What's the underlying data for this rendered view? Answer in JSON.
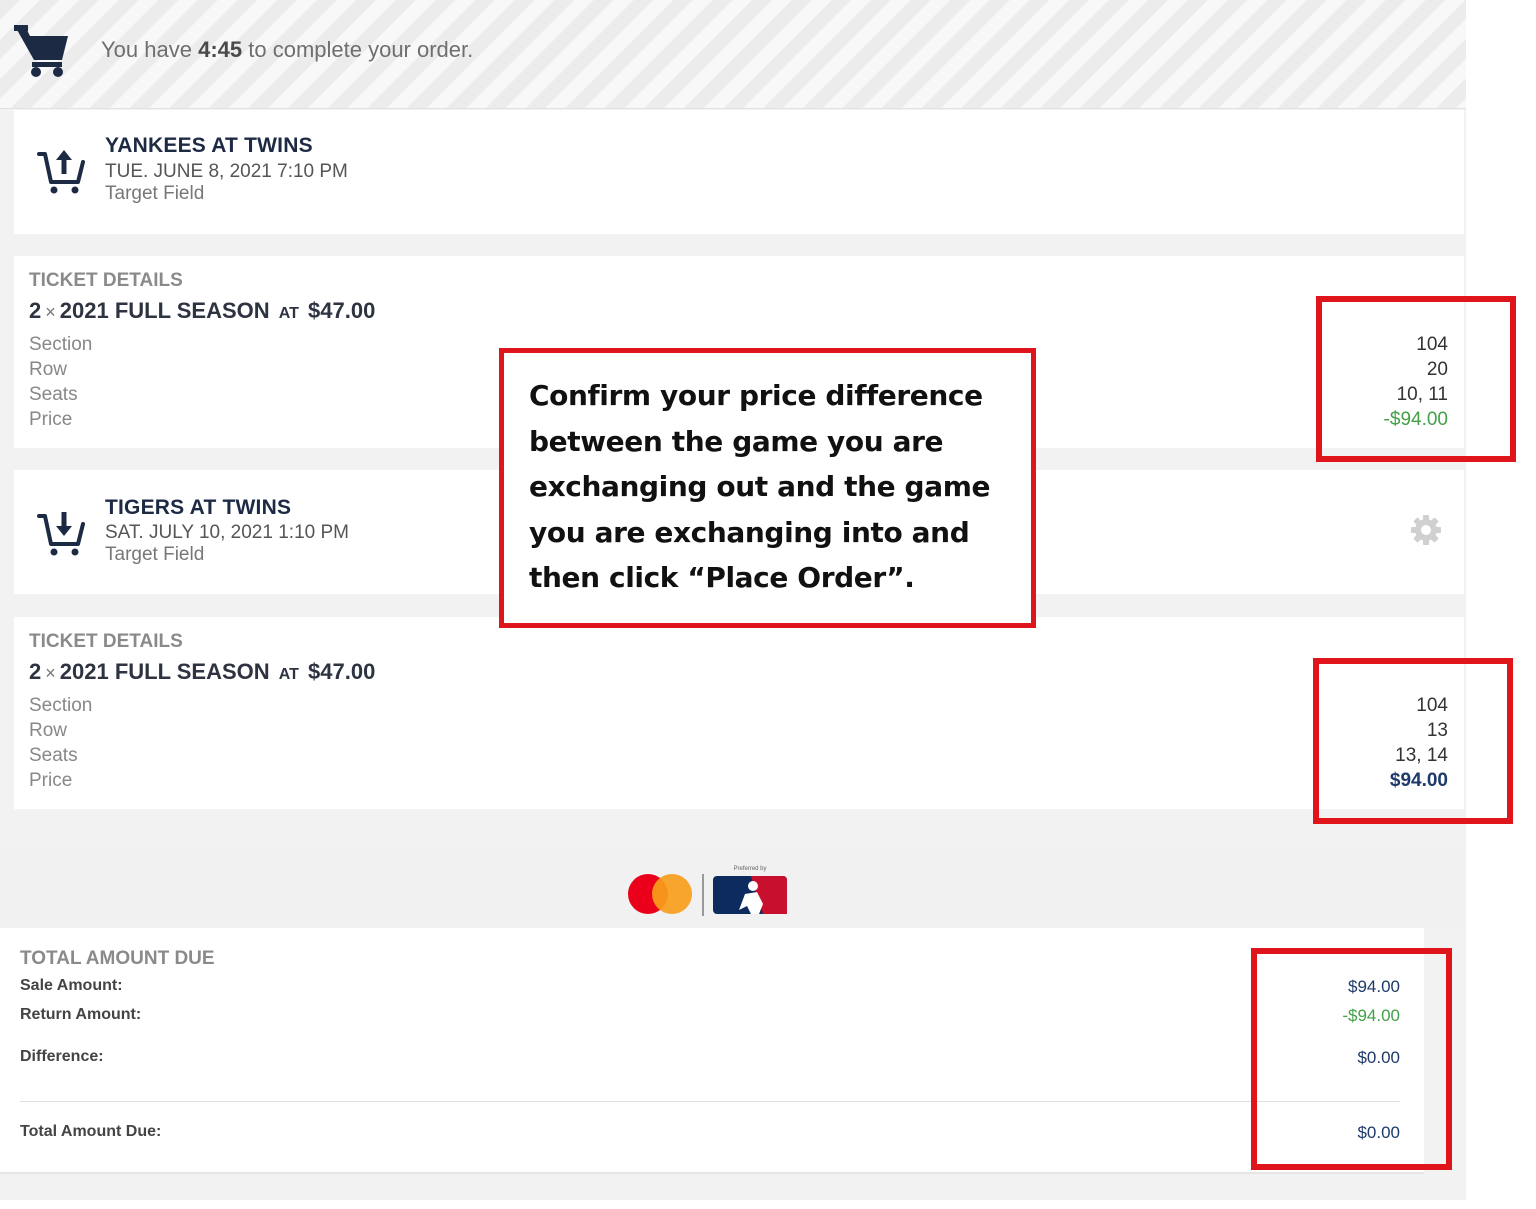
{
  "timer": {
    "prefix": "You have",
    "time": "4:45",
    "suffix": "to complete your order.",
    "icon": "cart-icon"
  },
  "exchange_out": {
    "icon": "cart-upload-icon",
    "title": "YANKEES AT TWINS",
    "datetime": "TUE. JUNE 8, 2021 7:10 PM",
    "venue": "Target Field",
    "ticket_details": {
      "heading": "TICKET DETAILS",
      "quantity": "2",
      "times": "×",
      "package": "2021 FULL SEASON",
      "at": "AT",
      "unit_price": "$47.00",
      "labels": [
        "Section",
        "Row",
        "Seats",
        "Price"
      ],
      "section": "104",
      "row": "20",
      "seats": "10, 11",
      "price": "-$94.00"
    }
  },
  "exchange_in": {
    "icon": "cart-download-icon",
    "title": "TIGERS AT TWINS",
    "datetime": "SAT. JULY 10, 2021 1:10 PM",
    "venue": "Target Field",
    "settings_icon": "gear-icon",
    "ticket_details": {
      "heading": "TICKET DETAILS",
      "quantity": "2",
      "times": "×",
      "package": "2021 FULL SEASON",
      "at": "AT",
      "unit_price": "$47.00",
      "labels": [
        "Section",
        "Row",
        "Seats",
        "Price"
      ],
      "section": "104",
      "row": "13",
      "seats": "13, 14",
      "price": "$94.00"
    }
  },
  "payment_logos": {
    "card_logo": "mastercard-logo",
    "sponsor_logo": "mlb-logo",
    "sponsor_caption": "Preferred by"
  },
  "totals": {
    "heading": "TOTAL AMOUNT DUE",
    "sale_label": "Sale Amount:",
    "sale_value": "$94.00",
    "return_label": "Return Amount:",
    "return_value": "-$94.00",
    "difference_label": "Difference:",
    "difference_value": "$0.00",
    "total_label": "Total Amount Due:",
    "total_value": "$0.00"
  },
  "callout": {
    "text": "Confirm your price difference between the game you are exchanging out and the game you are exchanging into and then click “Place Order”."
  },
  "colors": {
    "navy": "#1d2a44",
    "negative_green": "#43a047",
    "highlight_red": "#e0141b",
    "mastercard_red": "#eb001b",
    "mastercard_orange": "#f79e1b"
  }
}
